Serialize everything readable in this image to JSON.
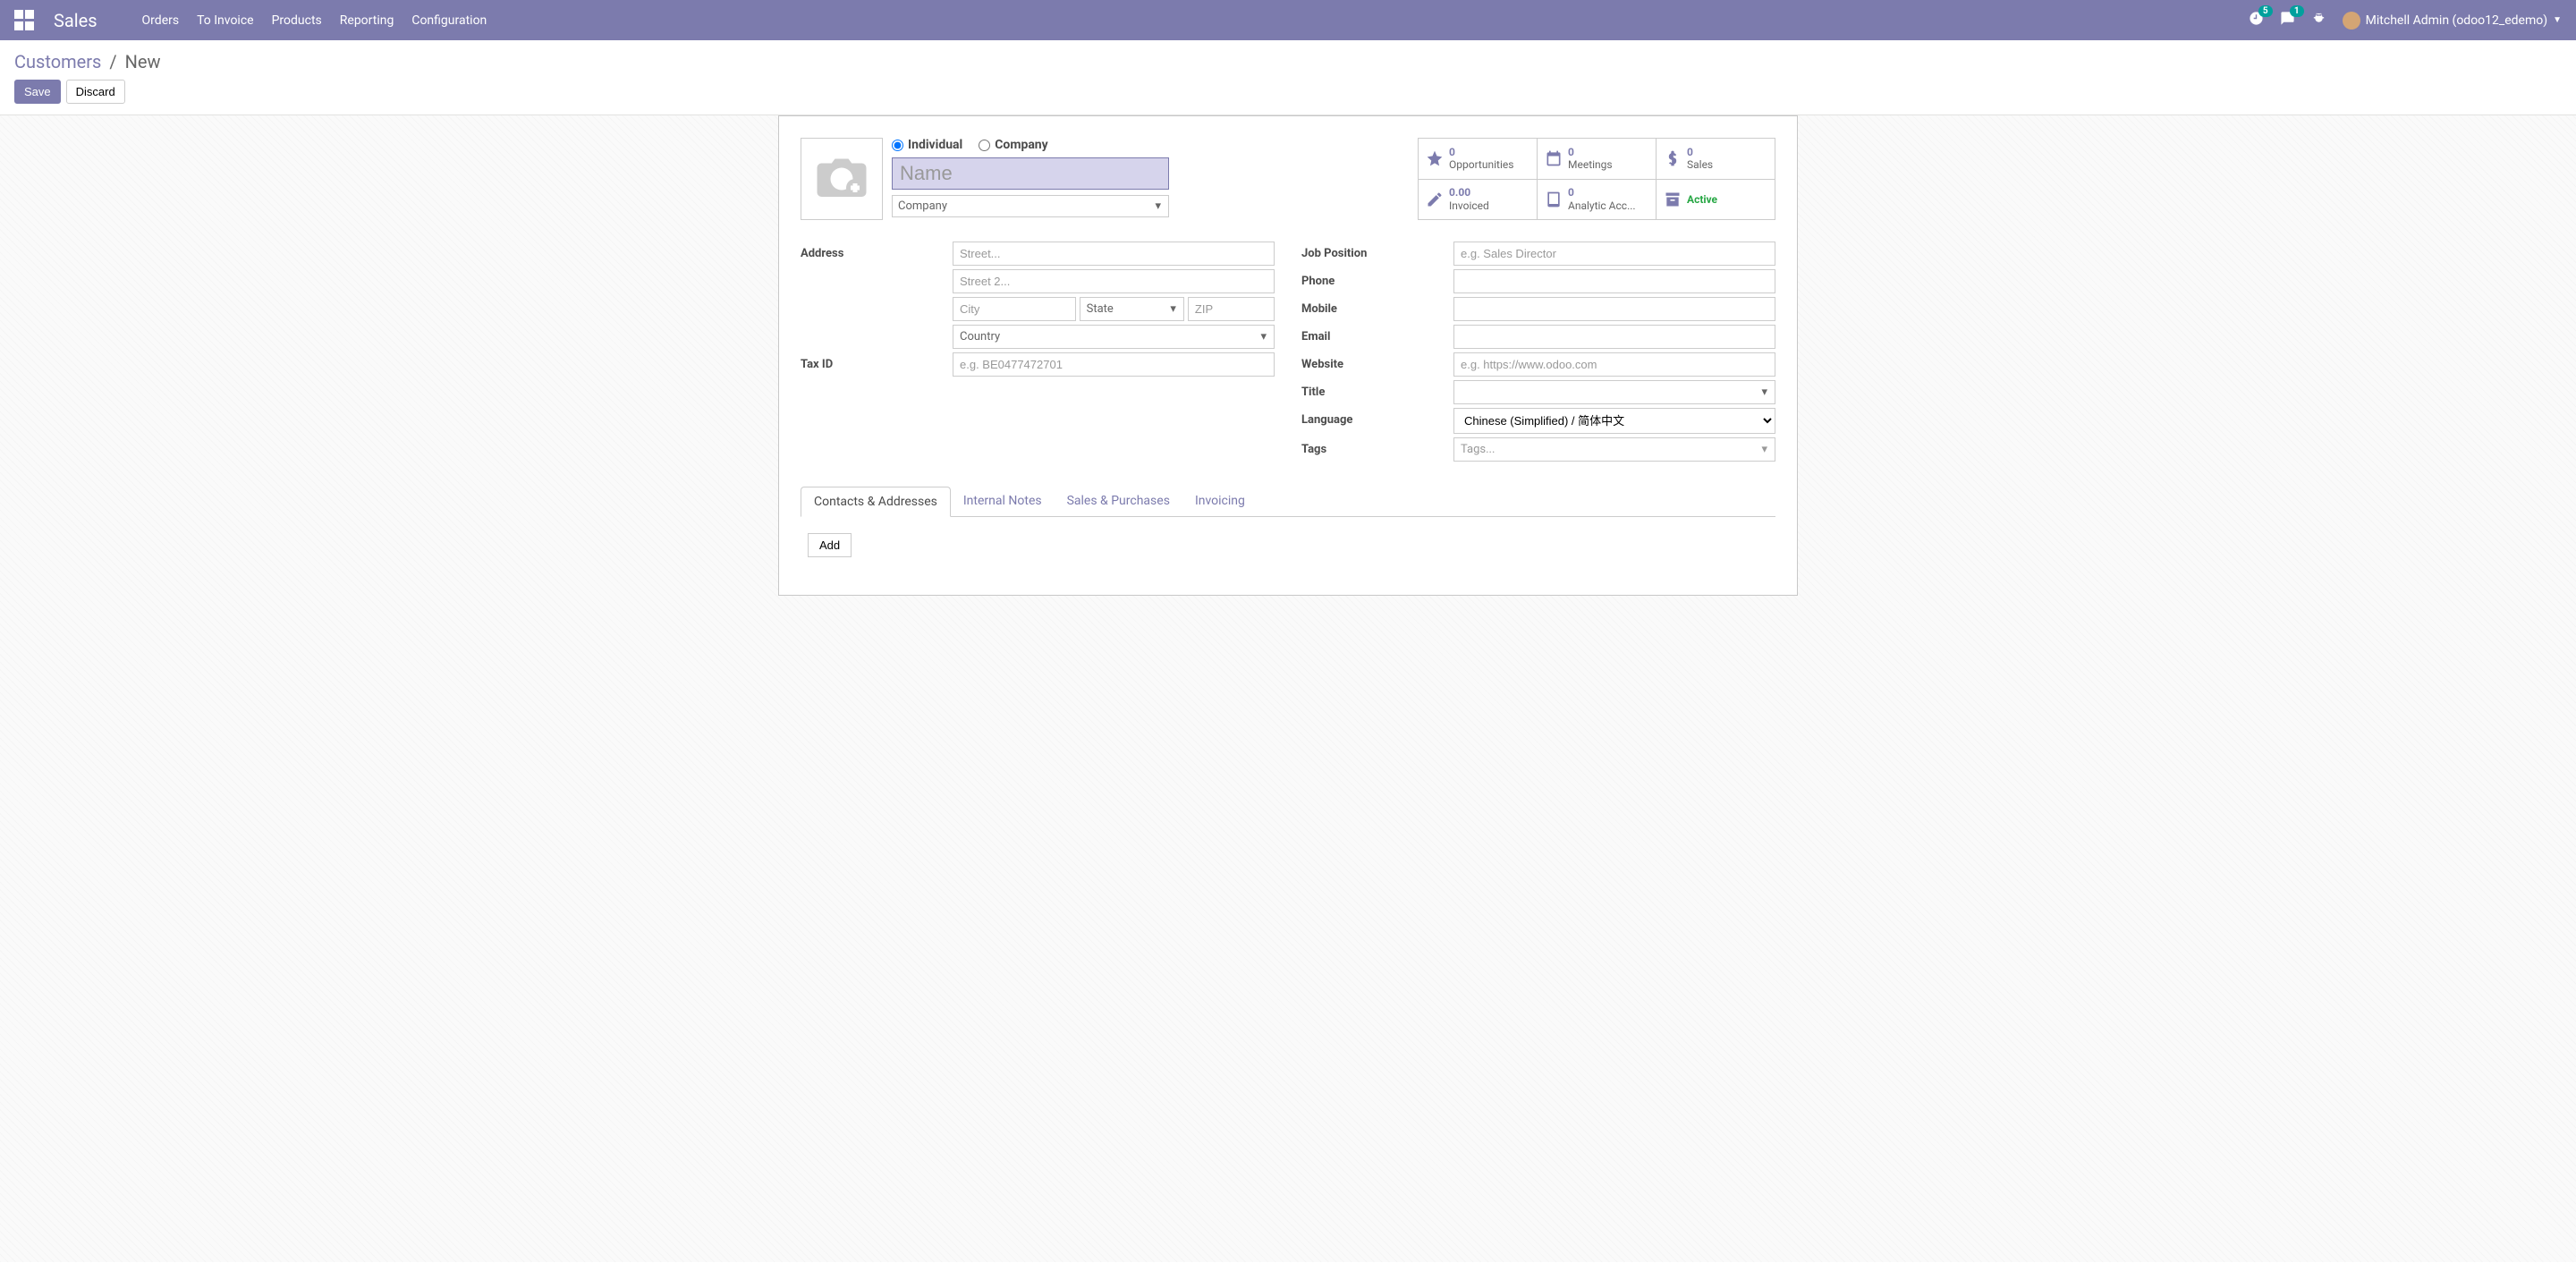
{
  "navbar": {
    "brand": "Sales",
    "menu": [
      "Orders",
      "To Invoice",
      "Products",
      "Reporting",
      "Configuration"
    ],
    "activities_badge": "5",
    "messages_badge": "1",
    "user_name": "Mitchell Admin (odoo12_edemo)"
  },
  "breadcrumb": {
    "link": "Customers",
    "sep": "/",
    "current": "New"
  },
  "buttons": {
    "save": "Save",
    "discard": "Discard",
    "add": "Add"
  },
  "radios": {
    "individual": "Individual",
    "company": "Company"
  },
  "name_placeholder": "Name",
  "company_placeholder": "Company",
  "stats": {
    "opportunities": {
      "value": "0",
      "label": "Opportunities"
    },
    "meetings": {
      "value": "0",
      "label": "Meetings"
    },
    "sales": {
      "value": "0",
      "label": "Sales"
    },
    "invoiced": {
      "value": "0.00",
      "label": "Invoiced"
    },
    "analytic": {
      "value": "0",
      "label": "Analytic Acc..."
    },
    "active": {
      "label": "Active"
    }
  },
  "labels": {
    "address": "Address",
    "tax_id": "Tax ID",
    "job_position": "Job Position",
    "phone": "Phone",
    "mobile": "Mobile",
    "email": "Email",
    "website": "Website",
    "title": "Title",
    "language": "Language",
    "tags": "Tags"
  },
  "placeholders": {
    "street": "Street...",
    "street2": "Street 2...",
    "city": "City",
    "state": "State",
    "zip": "ZIP",
    "country": "Country",
    "tax_id": "e.g. BE0477472701",
    "job_position": "e.g. Sales Director",
    "website": "e.g. https://www.odoo.com",
    "tags": "Tags..."
  },
  "language_value": "Chinese (Simplified) / 简体中文",
  "tabs": {
    "contacts": "Contacts & Addresses",
    "notes": "Internal Notes",
    "sales": "Sales & Purchases",
    "invoicing": "Invoicing"
  }
}
